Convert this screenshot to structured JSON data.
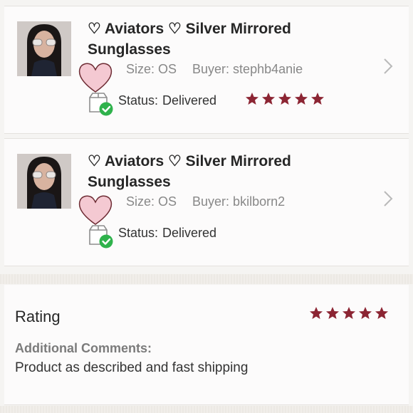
{
  "orders": [
    {
      "title": "♡ Aviators ♡ Silver Mirrored Sunglasses",
      "size": "Size: OS",
      "buyer": "Buyer: stephb4anie",
      "status_label": "Status:",
      "status_value": "Delivered",
      "rating": 5,
      "thumbnail_icon": "product-photo",
      "chevron_icon": "chevron-right-icon"
    },
    {
      "title": "♡ Aviators ♡ Silver Mirrored Sunglasses",
      "size": "Size: OS",
      "buyer": "Buyer: bkilborn2",
      "status_label": "Status:",
      "status_value": "Delivered",
      "rating": null,
      "thumbnail_icon": "product-photo",
      "chevron_icon": "chevron-right-icon"
    }
  ],
  "rating_section": {
    "title": "Rating",
    "stars": 5,
    "comments_label": "Additional Comments:",
    "comments_text": "Product as described and fast shipping"
  },
  "colors": {
    "star": "#8c2533",
    "delivered_check": "#2fb24c",
    "heart_fill": "#f4c9d2",
    "heart_stroke": "#6d2b33"
  }
}
